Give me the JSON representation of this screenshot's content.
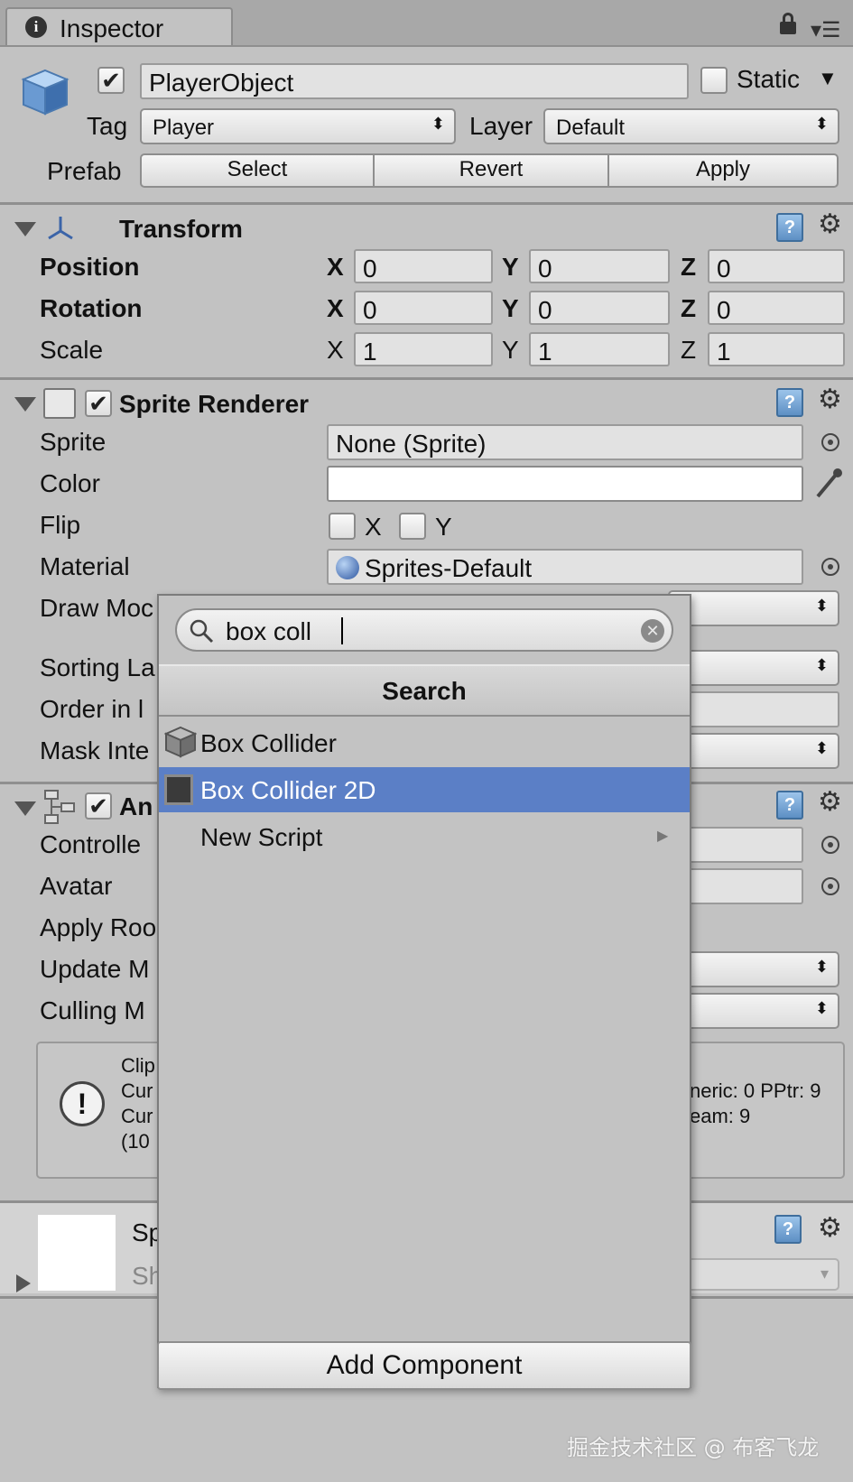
{
  "inspector": {
    "tab_title": "Inspector",
    "object_name": "PlayerObject",
    "static_label": "Static",
    "tag_label": "Tag",
    "tag_value": "Player",
    "layer_label": "Layer",
    "layer_value": "Default",
    "prefab_label": "Prefab",
    "prefab_buttons": [
      "Select",
      "Revert",
      "Apply"
    ]
  },
  "transform": {
    "title": "Transform",
    "rows": [
      {
        "label": "Position",
        "x": "0",
        "y": "0",
        "z": "0"
      },
      {
        "label": "Rotation",
        "x": "0",
        "y": "0",
        "z": "0"
      },
      {
        "label": "Scale",
        "x": "1",
        "y": "1",
        "z": "1"
      }
    ],
    "axis": {
      "x": "X",
      "y": "Y",
      "z": "Z"
    }
  },
  "sprite_renderer": {
    "title": "Sprite Renderer",
    "sprite_label": "Sprite",
    "sprite_value": "None (Sprite)",
    "color_label": "Color",
    "flip_label": "Flip",
    "flip_x": "X",
    "flip_y": "Y",
    "material_label": "Material",
    "material_value": "Sprites-Default",
    "draw_mode_label": "Draw Moc",
    "sorting_label": "Sorting La",
    "order_label": "Order in l",
    "mask_label": "Mask Inte"
  },
  "animator": {
    "title": "An",
    "controller_label": "Controlle",
    "avatar_label": "Avatar",
    "apply_root_label": "Apply Roo",
    "update_label": "Update M",
    "culling_label": "Culling M",
    "info_left": [
      "Clip",
      "Cur",
      "Cur",
      "(10"
    ],
    "info_right": [
      "neric: 0 PPtr: 9",
      "eam: 9"
    ]
  },
  "material_asset": {
    "title": "Sp",
    "shader": "Sh"
  },
  "add_component": {
    "search_value": "box coll",
    "header": "Search",
    "items": [
      {
        "label": "Box Collider",
        "selected": false
      },
      {
        "label": "Box Collider 2D",
        "selected": true
      }
    ],
    "new_script": "New Script",
    "button_label": "Add Component"
  },
  "watermark": "掘金技术社区 @ 布客飞龙",
  "colors": {
    "selection": "#5b7fc6",
    "panel": "#c2c2c2",
    "help_icon": "#5d8fc4"
  }
}
